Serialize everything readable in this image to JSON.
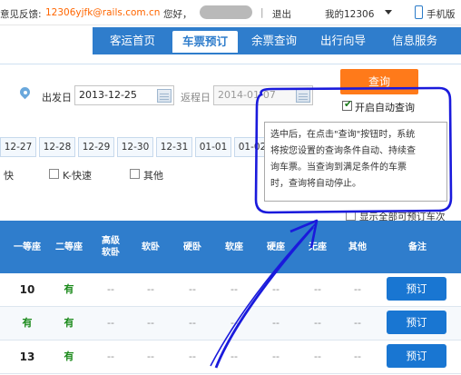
{
  "topbar": {
    "feedback_label": "意见反馈:",
    "feedback_email": "12306yjfk@rails.com.cn",
    "greeting": "您好，",
    "separator": "|",
    "logout": "退出",
    "my12306": "我的12306",
    "mobile": "手机版"
  },
  "nav": {
    "items": [
      {
        "label": "客运首页"
      },
      {
        "label": "车票预订"
      },
      {
        "label": "余票查询"
      },
      {
        "label": "出行向导"
      },
      {
        "label": "信息服务"
      }
    ]
  },
  "search": {
    "depart_label": "出发日",
    "depart_date": "2013-12-25",
    "return_label": "返程日",
    "return_date": "2014-01-07",
    "query_button": "查询",
    "auto_query_label": "开启自动查询",
    "auto_query_checked": true
  },
  "date_tabs": [
    "12-27",
    "12-28",
    "12-29",
    "12-30",
    "12-31",
    "01-01",
    "01-02"
  ],
  "filters": {
    "fast_label": "快",
    "k_label": "K-快速",
    "other_label": "其他"
  },
  "tooltip": {
    "lines": [
      "选中后，在点击\"查询\"按钮时，系统",
      "将按您设置的查询条件自动、持续查",
      "询车票。当查询到满足条件的车票",
      "时，查询将自动停止。"
    ]
  },
  "show_all_label": "显示全部可预订车次",
  "table": {
    "headers": [
      "一等座",
      "二等座",
      "高级\n软卧",
      "软卧",
      "硬卧",
      "软座",
      "硬座",
      "无座",
      "其他",
      "备注"
    ],
    "rows": [
      [
        "10",
        "有",
        "--",
        "--",
        "--",
        "--",
        "--",
        "--",
        "--"
      ],
      [
        "有",
        "有",
        "--",
        "--",
        "--",
        "--",
        "--",
        "--",
        "--"
      ],
      [
        "13",
        "有",
        "--",
        "--",
        "--",
        "--",
        "--",
        "--",
        "--"
      ]
    ],
    "book_label": "预订"
  },
  "colors": {
    "nav_blue": "#2f7dcc",
    "query_orange": "#ff7a1a",
    "annotation_blue": "#1a1adc",
    "available_green": "#1a8a1a",
    "email_orange": "#ff6600"
  }
}
